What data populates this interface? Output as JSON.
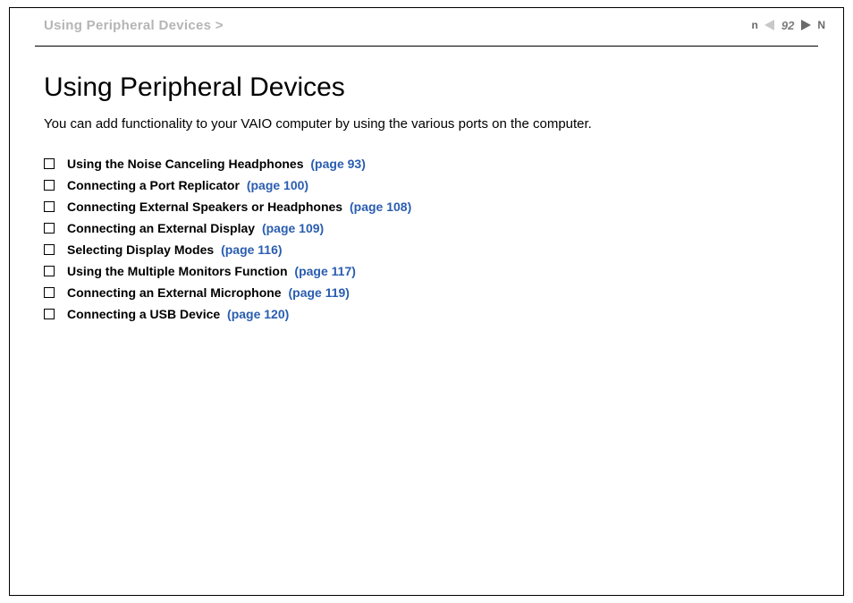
{
  "header": {
    "breadcrumb": "Using Peripheral Devices >",
    "page_number": "92",
    "n_letter": "n",
    "N_letter": "N"
  },
  "content": {
    "title": "Using Peripheral Devices",
    "intro": "You can add functionality to your VAIO computer by using the various ports on the computer."
  },
  "toc": [
    {
      "label": "Using the Noise Canceling Headphones",
      "page_ref": "(page 93)"
    },
    {
      "label": "Connecting a Port Replicator",
      "page_ref": "(page 100)"
    },
    {
      "label": "Connecting External Speakers or Headphones",
      "page_ref": "(page 108)"
    },
    {
      "label": "Connecting an External Display",
      "page_ref": "(page 109)"
    },
    {
      "label": "Selecting Display Modes",
      "page_ref": "(page 116)"
    },
    {
      "label": "Using the Multiple Monitors Function",
      "page_ref": "(page 117)"
    },
    {
      "label": "Connecting an External Microphone",
      "page_ref": "(page 119)"
    },
    {
      "label": "Connecting a USB Device",
      "page_ref": "(page 120)"
    }
  ]
}
